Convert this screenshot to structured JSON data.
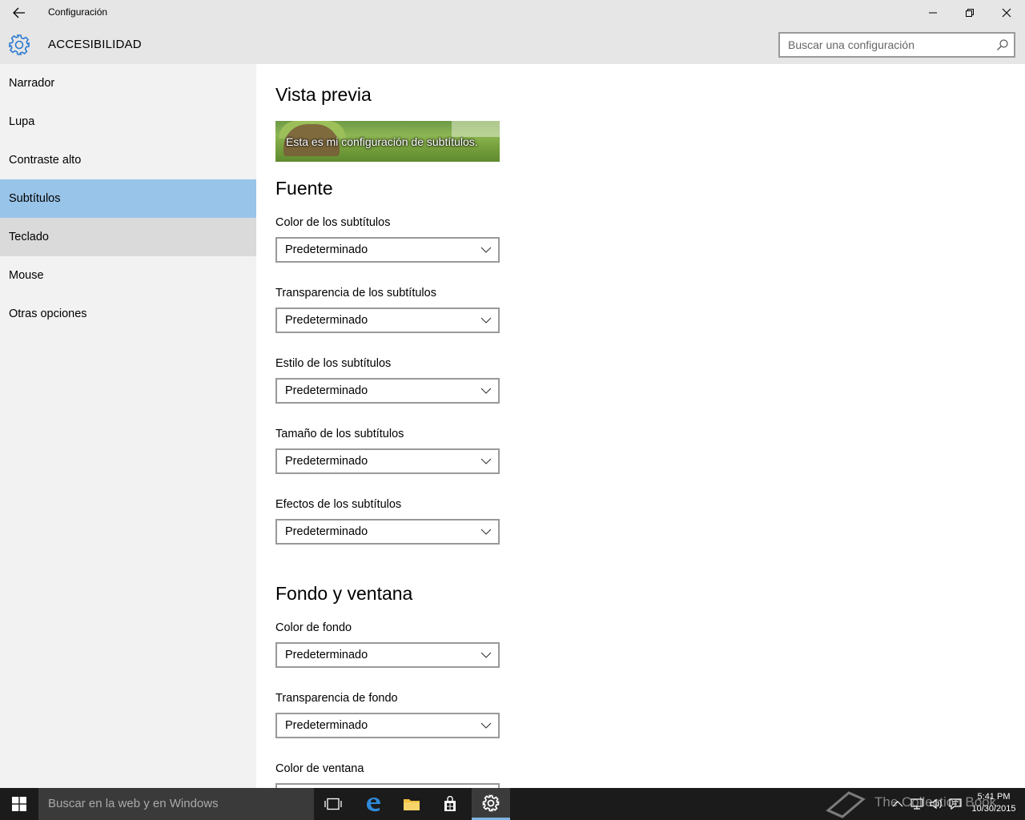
{
  "window": {
    "title": "Configuración"
  },
  "header": {
    "section_title": "ACCESIBILIDAD",
    "search_placeholder": "Buscar una configuración"
  },
  "sidebar": {
    "items": [
      {
        "label": "Narrador"
      },
      {
        "label": "Lupa"
      },
      {
        "label": "Contraste alto"
      },
      {
        "label": "Subtítulos",
        "state": "selected"
      },
      {
        "label": "Teclado",
        "state": "hover"
      },
      {
        "label": "Mouse"
      },
      {
        "label": "Otras opciones"
      }
    ]
  },
  "main": {
    "preview": {
      "heading": "Vista previa",
      "caption": "Esta es mi configuración de subtítulos."
    },
    "font_section": {
      "heading": "Fuente",
      "fields": [
        {
          "label": "Color de los subtítulos",
          "value": "Predeterminado"
        },
        {
          "label": "Transparencia de los subtítulos",
          "value": "Predeterminado"
        },
        {
          "label": "Estilo de los subtítulos",
          "value": "Predeterminado"
        },
        {
          "label": "Tamaño de los subtítulos",
          "value": "Predeterminado"
        },
        {
          "label": "Efectos de los subtítulos",
          "value": "Predeterminado"
        }
      ]
    },
    "background_section": {
      "heading": "Fondo y ventana",
      "fields": [
        {
          "label": "Color de fondo",
          "value": "Predeterminado"
        },
        {
          "label": "Transparencia de fondo",
          "value": "Predeterminado"
        },
        {
          "label": "Color de ventana",
          "value": ""
        }
      ]
    }
  },
  "taskbar": {
    "search_text": "Buscar en la web y en Windows",
    "clock_time": "5:41 PM",
    "clock_date": "10/30/2015",
    "watermark": "The Collection Book"
  },
  "colors": {
    "accent": "#99c4e9",
    "chrome": "#e6e6e6",
    "sidebar": "#f2f2f2",
    "taskbar": "#1b1b1b",
    "gear_blue": "#2a7ad1"
  }
}
